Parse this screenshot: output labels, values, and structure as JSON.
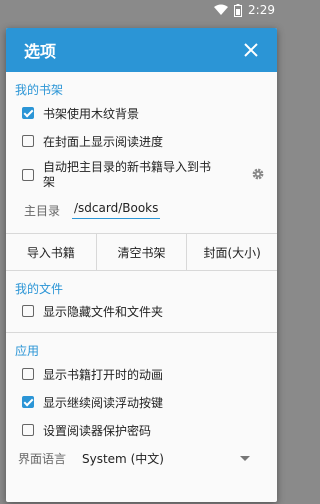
{
  "statusbar": {
    "time": "2:29"
  },
  "dialog": {
    "title": "选项",
    "sections": {
      "bookshelf": {
        "title": "我的书架",
        "wood_texture": {
          "label": "书架使用木纹背景",
          "checked": true
        },
        "show_progress": {
          "label": "在封面上显示阅读进度",
          "checked": false
        },
        "auto_import": {
          "label_line1": "自动把主目录的新书籍导入到书",
          "label_line2": "架",
          "checked": false
        },
        "home_dir": {
          "label": "主目录",
          "value": "/sdcard/Books"
        },
        "buttons": {
          "import": "导入书籍",
          "clear": "清空书架",
          "cover": "封面(大小)"
        }
      },
      "files": {
        "title": "我的文件",
        "show_hidden": {
          "label": "显示隐藏文件和文件夹",
          "checked": false
        }
      },
      "app": {
        "title": "应用",
        "open_animation": {
          "label": "显示书籍打开时的动画",
          "checked": false
        },
        "floating_button": {
          "label": "显示继续阅读浮动按键",
          "checked": true
        },
        "password": {
          "label": "设置阅读器保护密码",
          "checked": false
        },
        "language": {
          "label": "界面语言",
          "value": "System (中文)"
        }
      }
    }
  },
  "colors": {
    "accent": "#2b95d6",
    "scrim": "#8a8a8a",
    "surface": "#fafafa"
  }
}
